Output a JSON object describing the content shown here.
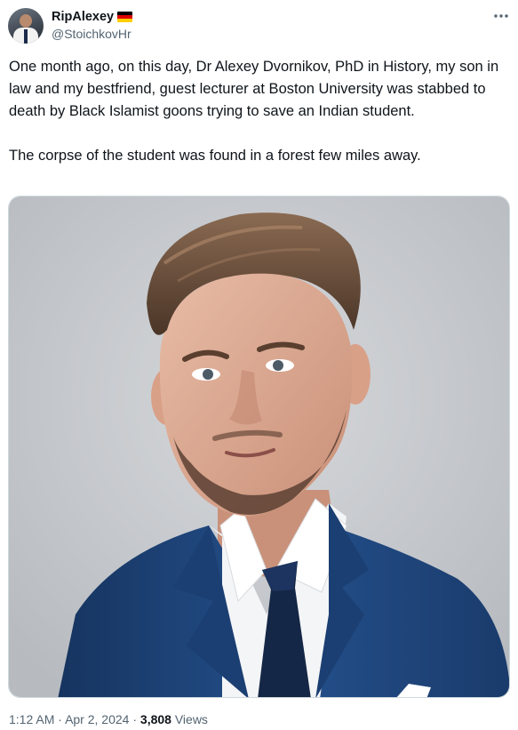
{
  "author": {
    "display_name": "RipAlexey",
    "handle": "@StoichkovHr",
    "avatar_icon": "user-avatar-icon",
    "badge_icon": "germany-flag-icon",
    "flag_colors": [
      "#000000",
      "#dd0000",
      "#ffce00"
    ]
  },
  "more_icon": "more-options-icon",
  "tweet": {
    "paragraphs": [
      "One month ago, on this day, Dr Alexey Dvornikov, PhD in History, my son in law and my bestfriend, guest lecturer at Boston University was stabbed to death by Black Islamist goons trying to save an Indian student.",
      "The corpse of the student was found in a forest few miles away."
    ]
  },
  "media": {
    "kind": "photo",
    "background": "#c9ccd0",
    "suit_color": "#1f4478",
    "shirt_color": "#f4f5f7",
    "tie_color": "#152746"
  },
  "meta": {
    "time": "1:12 AM",
    "separator": "·",
    "date": "Apr 2, 2024",
    "views_count": "3,808",
    "views_label": "Views"
  },
  "colors": {
    "text_primary": "#0f1419",
    "text_secondary": "#536471",
    "border": "#cfd9de"
  }
}
